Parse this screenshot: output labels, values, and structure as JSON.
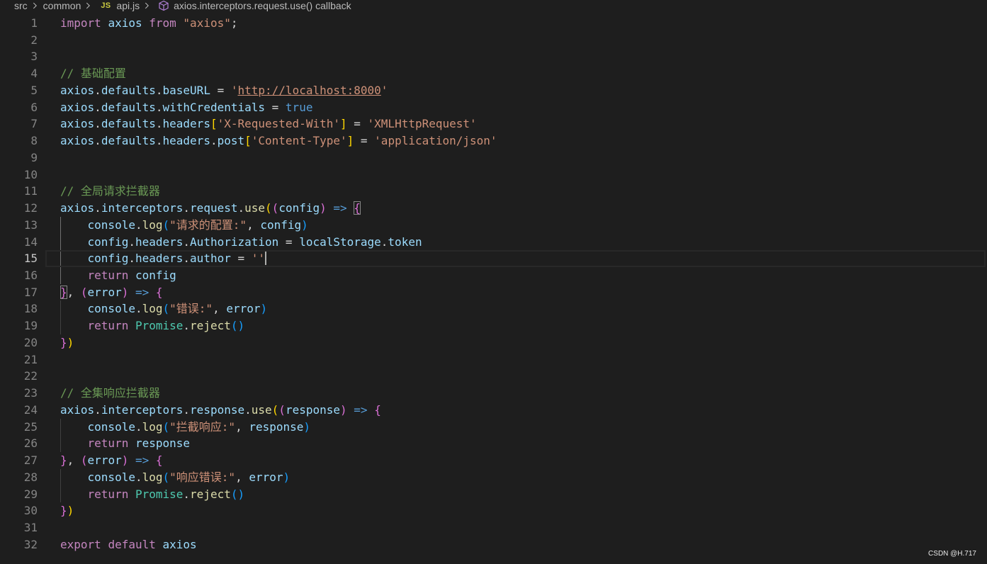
{
  "theme": {
    "bg": "#1e1e1e",
    "fg": "#d4d4d4",
    "line-number": "#858585",
    "line-number-active": "#c6c6c6",
    "line-highlight-border": "#282828",
    "indent-guide": "#404040",
    "indent-guide-active": "#707070",
    "bracket-match-border": "#888888",
    "cursor": "#aeafad",
    "breadcrumb-fg": "#bbbbbb",
    "js-icon": "#cbcb41",
    "method-icon": "#b180d7",
    "watermark": "#e8e8e8"
  },
  "breadcrumb": {
    "separator_icon": "chevron-right-icon",
    "items": [
      {
        "label": "src"
      },
      {
        "label": "common"
      },
      {
        "label": "api.js",
        "icon": "js-file-icon",
        "icon_text": "JS"
      },
      {
        "label": "axios.interceptors.request.use() callback",
        "icon": "symbol-method-icon"
      }
    ]
  },
  "code": {
    "token_colors": {
      "keyword": "#c586c0",
      "variable": "#9cdcfe",
      "function": "#dcdcaa",
      "string": "#ce9178",
      "link": "#ce9178",
      "comment": "#6a9955",
      "constant": "#569cd6",
      "class": "#4ec9b0",
      "arrow": "#569cd6",
      "plain": "#d4d4d4",
      "indent": "#d4d4d4",
      "bracket1": "#ffd700",
      "bracket2": "#da70d6",
      "bracket3": "#179fff"
    },
    "lines": [
      {
        "n": "1",
        "tokens": [
          {
            "keyword": "import"
          },
          {
            "plain": " "
          },
          {
            "variable": "axios"
          },
          {
            "plain": " "
          },
          {
            "keyword": "from"
          },
          {
            "plain": " "
          },
          {
            "string": "\"axios\""
          },
          {
            "plain": ";"
          }
        ]
      },
      {
        "n": "2",
        "tokens": []
      },
      {
        "n": "3",
        "tokens": []
      },
      {
        "n": "4",
        "tokens": [
          {
            "comment": "// 基础配置"
          }
        ]
      },
      {
        "n": "5",
        "tokens": [
          {
            "variable": "axios"
          },
          {
            "plain": "."
          },
          {
            "variable": "defaults"
          },
          {
            "plain": "."
          },
          {
            "variable": "baseURL"
          },
          {
            "plain": " = "
          },
          {
            "string": "'"
          },
          {
            "link": "http://localhost:8000"
          },
          {
            "string": "'"
          }
        ]
      },
      {
        "n": "6",
        "tokens": [
          {
            "variable": "axios"
          },
          {
            "plain": "."
          },
          {
            "variable": "defaults"
          },
          {
            "plain": "."
          },
          {
            "variable": "withCredentials"
          },
          {
            "plain": " = "
          },
          {
            "constant": "true"
          }
        ]
      },
      {
        "n": "7",
        "tokens": [
          {
            "variable": "axios"
          },
          {
            "plain": "."
          },
          {
            "variable": "defaults"
          },
          {
            "plain": "."
          },
          {
            "variable": "headers"
          },
          {
            "bracket1": "["
          },
          {
            "string": "'X-Requested-With'"
          },
          {
            "bracket1": "]"
          },
          {
            "plain": " = "
          },
          {
            "string": "'XMLHttpRequest'"
          }
        ]
      },
      {
        "n": "8",
        "tokens": [
          {
            "variable": "axios"
          },
          {
            "plain": "."
          },
          {
            "variable": "defaults"
          },
          {
            "plain": "."
          },
          {
            "variable": "headers"
          },
          {
            "plain": "."
          },
          {
            "variable": "post"
          },
          {
            "bracket1": "["
          },
          {
            "string": "'Content-Type'"
          },
          {
            "bracket1": "]"
          },
          {
            "plain": " = "
          },
          {
            "string": "'application/json'"
          }
        ]
      },
      {
        "n": "9",
        "tokens": []
      },
      {
        "n": "10",
        "tokens": []
      },
      {
        "n": "11",
        "tokens": [
          {
            "comment": "// 全局请求拦截器"
          }
        ]
      },
      {
        "n": "12",
        "tokens": [
          {
            "variable": "axios"
          },
          {
            "plain": "."
          },
          {
            "variable": "interceptors"
          },
          {
            "plain": "."
          },
          {
            "variable": "request"
          },
          {
            "plain": "."
          },
          {
            "function": "use"
          },
          {
            "bracket1": "("
          },
          {
            "bracket2": "("
          },
          {
            "variable": "config"
          },
          {
            "bracket2": ")"
          },
          {
            "plain": " "
          },
          {
            "arrow": "=>"
          },
          {
            "plain": " "
          },
          {
            "bracket2": "{",
            "match": true
          }
        ]
      },
      {
        "n": "13",
        "active_indent_guide": true,
        "tokens": [
          {
            "indent": "    "
          },
          {
            "variable": "console"
          },
          {
            "plain": "."
          },
          {
            "function": "log"
          },
          {
            "bracket3": "("
          },
          {
            "string": "\"请求的配置:\""
          },
          {
            "plain": ", "
          },
          {
            "variable": "config"
          },
          {
            "bracket3": ")"
          }
        ]
      },
      {
        "n": "14",
        "active_indent_guide": true,
        "tokens": [
          {
            "indent": "    "
          },
          {
            "variable": "config"
          },
          {
            "plain": "."
          },
          {
            "variable": "headers"
          },
          {
            "plain": "."
          },
          {
            "variable": "Authorization"
          },
          {
            "plain": " = "
          },
          {
            "variable": "localStorage"
          },
          {
            "plain": "."
          },
          {
            "variable": "token"
          }
        ]
      },
      {
        "n": "15",
        "current": true,
        "cursor": true,
        "active_indent_guide": true,
        "tokens": [
          {
            "indent": "    "
          },
          {
            "variable": "config"
          },
          {
            "plain": "."
          },
          {
            "variable": "headers"
          },
          {
            "plain": "."
          },
          {
            "variable": "author"
          },
          {
            "plain": " = "
          },
          {
            "string": "''"
          }
        ]
      },
      {
        "n": "16",
        "active_indent_guide": true,
        "tokens": [
          {
            "indent": "    "
          },
          {
            "keyword": "return"
          },
          {
            "plain": " "
          },
          {
            "variable": "config"
          }
        ]
      },
      {
        "n": "17",
        "tokens": [
          {
            "bracket2": "}",
            "match": true
          },
          {
            "plain": ", "
          },
          {
            "bracket2": "("
          },
          {
            "variable": "error"
          },
          {
            "bracket2": ")"
          },
          {
            "plain": " "
          },
          {
            "arrow": "=>"
          },
          {
            "plain": " "
          },
          {
            "bracket2": "{"
          }
        ]
      },
      {
        "n": "18",
        "tokens": [
          {
            "indent": "    "
          },
          {
            "variable": "console"
          },
          {
            "plain": "."
          },
          {
            "function": "log"
          },
          {
            "bracket3": "("
          },
          {
            "string": "\"错误:\""
          },
          {
            "plain": ", "
          },
          {
            "variable": "error"
          },
          {
            "bracket3": ")"
          }
        ]
      },
      {
        "n": "19",
        "tokens": [
          {
            "indent": "    "
          },
          {
            "keyword": "return"
          },
          {
            "plain": " "
          },
          {
            "class": "Promise"
          },
          {
            "plain": "."
          },
          {
            "function": "reject"
          },
          {
            "bracket3": "("
          },
          {
            "bracket3": ")"
          }
        ]
      },
      {
        "n": "20",
        "tokens": [
          {
            "bracket2": "}"
          },
          {
            "bracket1": ")"
          }
        ]
      },
      {
        "n": "21",
        "tokens": []
      },
      {
        "n": "22",
        "tokens": []
      },
      {
        "n": "23",
        "tokens": [
          {
            "comment": "// 全集响应拦截器"
          }
        ]
      },
      {
        "n": "24",
        "tokens": [
          {
            "variable": "axios"
          },
          {
            "plain": "."
          },
          {
            "variable": "interceptors"
          },
          {
            "plain": "."
          },
          {
            "variable": "response"
          },
          {
            "plain": "."
          },
          {
            "function": "use"
          },
          {
            "bracket1": "("
          },
          {
            "bracket2": "("
          },
          {
            "variable": "response"
          },
          {
            "bracket2": ")"
          },
          {
            "plain": " "
          },
          {
            "arrow": "=>"
          },
          {
            "plain": " "
          },
          {
            "bracket2": "{"
          }
        ]
      },
      {
        "n": "25",
        "tokens": [
          {
            "indent": "    "
          },
          {
            "variable": "console"
          },
          {
            "plain": "."
          },
          {
            "function": "log"
          },
          {
            "bracket3": "("
          },
          {
            "string": "\"拦截响应:\""
          },
          {
            "plain": ", "
          },
          {
            "variable": "response"
          },
          {
            "bracket3": ")"
          }
        ]
      },
      {
        "n": "26",
        "tokens": [
          {
            "indent": "    "
          },
          {
            "keyword": "return"
          },
          {
            "plain": " "
          },
          {
            "variable": "response"
          }
        ]
      },
      {
        "n": "27",
        "tokens": [
          {
            "bracket2": "}"
          },
          {
            "plain": ", "
          },
          {
            "bracket2": "("
          },
          {
            "variable": "error"
          },
          {
            "bracket2": ")"
          },
          {
            "plain": " "
          },
          {
            "arrow": "=>"
          },
          {
            "plain": " "
          },
          {
            "bracket2": "{"
          }
        ]
      },
      {
        "n": "28",
        "tokens": [
          {
            "indent": "    "
          },
          {
            "variable": "console"
          },
          {
            "plain": "."
          },
          {
            "function": "log"
          },
          {
            "bracket3": "("
          },
          {
            "string": "\"响应错误:\""
          },
          {
            "plain": ", "
          },
          {
            "variable": "error"
          },
          {
            "bracket3": ")"
          }
        ]
      },
      {
        "n": "29",
        "tokens": [
          {
            "indent": "    "
          },
          {
            "keyword": "return"
          },
          {
            "plain": " "
          },
          {
            "class": "Promise"
          },
          {
            "plain": "."
          },
          {
            "function": "reject"
          },
          {
            "bracket3": "("
          },
          {
            "bracket3": ")"
          }
        ]
      },
      {
        "n": "30",
        "tokens": [
          {
            "bracket2": "}"
          },
          {
            "bracket1": ")"
          }
        ]
      },
      {
        "n": "31",
        "tokens": []
      },
      {
        "n": "32",
        "tokens": [
          {
            "keyword": "export"
          },
          {
            "plain": " "
          },
          {
            "keyword": "default"
          },
          {
            "plain": " "
          },
          {
            "variable": "axios"
          }
        ]
      }
    ]
  },
  "watermark": "CSDN @H.717"
}
